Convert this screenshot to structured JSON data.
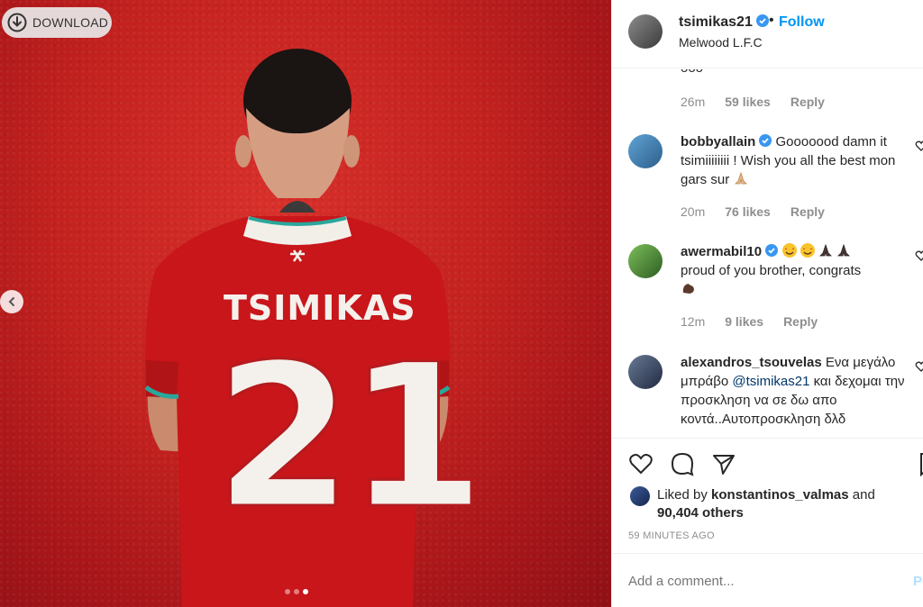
{
  "photo": {
    "download_label": "DOWNLOAD",
    "shirt_name": "TSIMIKAS",
    "shirt_number": "21",
    "carousel_dots": 3,
    "carousel_active": 3
  },
  "header": {
    "username": "tsimikas21",
    "separator": "•",
    "follow_label": "Follow",
    "location": "Melwood L.F.C"
  },
  "comments": {
    "partial_text": "ooo",
    "partial_meta": {
      "time": "26m",
      "likes": "59 likes",
      "reply": "Reply"
    },
    "items": [
      {
        "username": "bobbyallain",
        "text": "Gooooood damn it tsimiiiiiiii ! Wish you all the best mon gars sur",
        "time": "20m",
        "likes": "76 likes",
        "reply": "Reply"
      },
      {
        "username": "awermabil10",
        "text": "proud of you brother, congrats",
        "time": "12m",
        "likes": "9 likes",
        "reply": "Reply"
      },
      {
        "username": "alexandros_tsouvelas",
        "text_before": "Ενα μεγάλο μπράβο",
        "mention": "@tsimikas21",
        "text_after": "και δεχομαι την προσκληση να σε δω απο κοντά..Αυτοπροσκληση δλδ"
      }
    ]
  },
  "actions": {
    "liked_by_prefix": "Liked by",
    "liked_by_user": "konstantinos_valmas",
    "liked_by_and": "and",
    "liked_others": "90,404 others",
    "timestamp": "59 MINUTES AGO"
  },
  "add_comment": {
    "placeholder": "Add a comment...",
    "post_label": "Po"
  },
  "colors": {
    "accent": "#0095f6",
    "verified": "#3897f0",
    "photo_red": "#c4221f",
    "muted": "#8e8e8e"
  }
}
